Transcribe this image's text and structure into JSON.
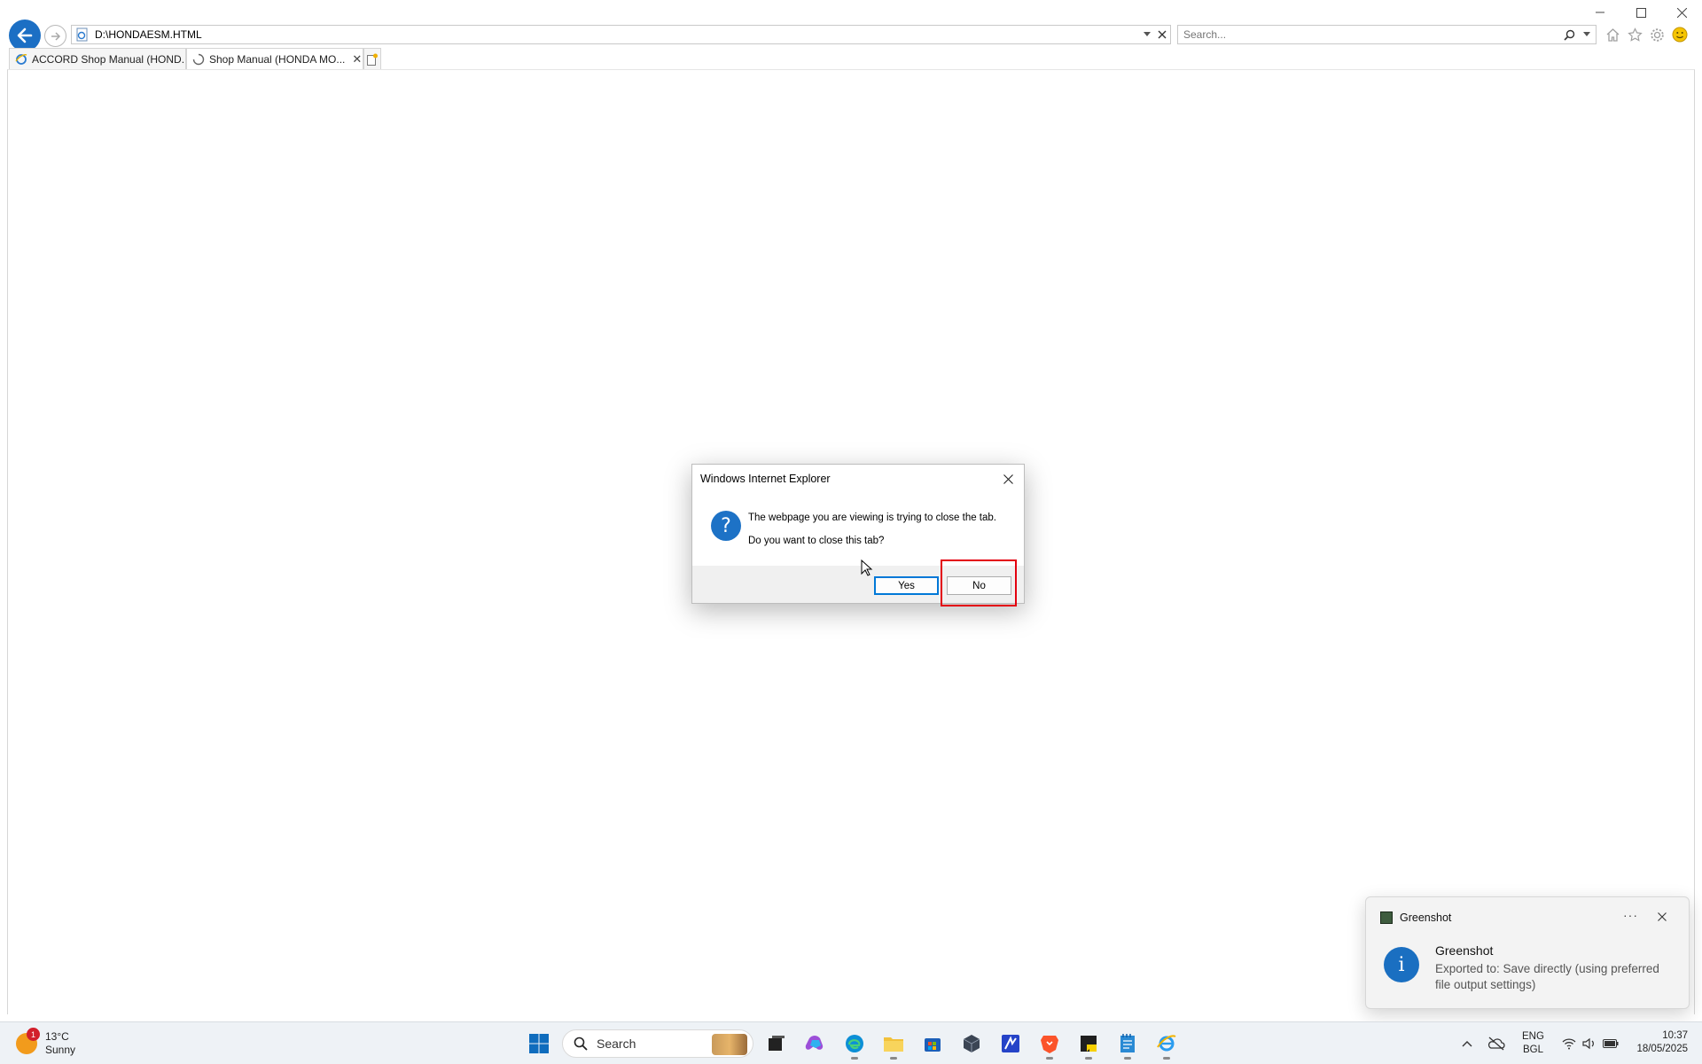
{
  "browser": {
    "address": "D:\\HONDAESM.HTML",
    "search_placeholder": "Search...",
    "tabs": [
      {
        "label": "ACCORD Shop Manual (HOND...",
        "active": false
      },
      {
        "label": "Shop Manual (HONDA MO...",
        "active": true
      }
    ]
  },
  "dialog": {
    "title": "Windows Internet Explorer",
    "message_line1": "The webpage you are viewing is trying to close the tab.",
    "message_line2": "Do you want to close this tab?",
    "yes_label": "Yes",
    "no_label": "No",
    "icon": "question-icon"
  },
  "toast": {
    "app_name": "Greenshot",
    "title": "Greenshot",
    "body": "Exported to: Save directly (using preferred file output settings)",
    "icon": "info-icon"
  },
  "taskbar": {
    "weather": {
      "temp": "13°C",
      "condition": "Sunny",
      "badge": "1"
    },
    "search_label": "Search",
    "lang_line1": "ENG",
    "lang_line2": "BGL",
    "time": "10:37",
    "date": "18/05/2025"
  },
  "colors": {
    "accent_blue": "#1c6fc4",
    "highlight_red": "#e3000f",
    "taskbar_bg": "#eef2f6"
  }
}
